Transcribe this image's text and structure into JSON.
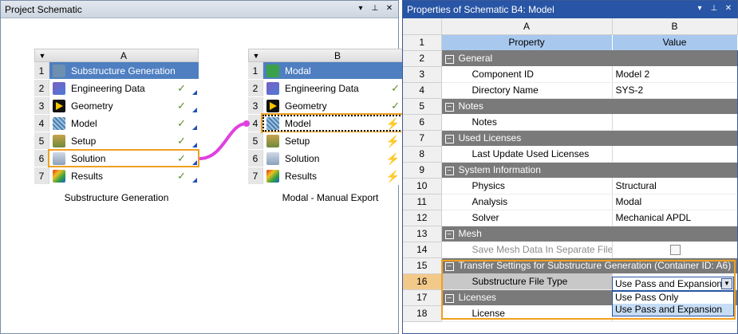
{
  "left_pane": {
    "title": "Project Schematic",
    "system_a": {
      "column": "A",
      "caption": "Substructure Generation",
      "rows": [
        {
          "num": "1",
          "label": "Substructure Generation",
          "icon": "substructure-icon",
          "status": ""
        },
        {
          "num": "2",
          "label": "Engineering Data",
          "icon": "engineering-data-icon",
          "status": "✓"
        },
        {
          "num": "3",
          "label": "Geometry",
          "icon": "geometry-icon",
          "status": "✓"
        },
        {
          "num": "4",
          "label": "Model",
          "icon": "model-icon",
          "status": "✓"
        },
        {
          "num": "5",
          "label": "Setup",
          "icon": "setup-icon",
          "status": "✓"
        },
        {
          "num": "6",
          "label": "Solution",
          "icon": "solution-icon",
          "status": "✓"
        },
        {
          "num": "7",
          "label": "Results",
          "icon": "results-icon",
          "status": "✓"
        }
      ]
    },
    "system_b": {
      "column": "B",
      "caption": "Modal - Manual Export",
      "rows": [
        {
          "num": "1",
          "label": "Modal",
          "icon": "modal-icon",
          "status": ""
        },
        {
          "num": "2",
          "label": "Engineering Data",
          "icon": "engineering-data-icon",
          "status": "✓"
        },
        {
          "num": "3",
          "label": "Geometry",
          "icon": "geometry-icon",
          "status": "✓"
        },
        {
          "num": "4",
          "label": "Model",
          "icon": "model-icon",
          "status": "⚡"
        },
        {
          "num": "5",
          "label": "Setup",
          "icon": "setup-icon",
          "status": "⚡"
        },
        {
          "num": "6",
          "label": "Solution",
          "icon": "solution-icon",
          "status": "⚡"
        },
        {
          "num": "7",
          "label": "Results",
          "icon": "results-icon",
          "status": "⚡"
        }
      ]
    }
  },
  "right_pane": {
    "title": "Properties of Schematic B4: Model",
    "col_a": "A",
    "col_b": "B",
    "row1": {
      "num": "1",
      "property": "Property",
      "value": "Value"
    },
    "rows": [
      {
        "num": "2",
        "type": "cat",
        "label": "General"
      },
      {
        "num": "3",
        "type": "item",
        "label": "Component ID",
        "value": "Model 2"
      },
      {
        "num": "4",
        "type": "item",
        "label": "Directory Name",
        "value": "SYS-2"
      },
      {
        "num": "5",
        "type": "cat",
        "label": "Notes"
      },
      {
        "num": "6",
        "type": "item",
        "label": "Notes",
        "value": ""
      },
      {
        "num": "7",
        "type": "cat",
        "label": "Used Licenses"
      },
      {
        "num": "8",
        "type": "item",
        "label": "Last Update Used Licenses",
        "value": ""
      },
      {
        "num": "9",
        "type": "cat",
        "label": "System Information"
      },
      {
        "num": "10",
        "type": "item",
        "label": "Physics",
        "value": "Structural"
      },
      {
        "num": "11",
        "type": "item",
        "label": "Analysis",
        "value": "Modal"
      },
      {
        "num": "12",
        "type": "item",
        "label": "Solver",
        "value": "Mechanical APDL"
      },
      {
        "num": "13",
        "type": "cat",
        "label": "Mesh"
      },
      {
        "num": "14",
        "type": "check",
        "label": "Save Mesh Data In Separate File",
        "value": ""
      },
      {
        "num": "15",
        "type": "cat",
        "label": "Transfer Settings for Substructure Generation (Container ID: A6)"
      },
      {
        "num": "16",
        "type": "sel",
        "label": "Substructure File Type",
        "value": ""
      },
      {
        "num": "17",
        "type": "cat",
        "label": "Licenses"
      },
      {
        "num": "18",
        "type": "item",
        "label": "License",
        "value": ""
      }
    ],
    "dropdown": {
      "selected": "Use Pass and Expansion",
      "options": [
        "Use Pass Only",
        "Use Pass and Expansion"
      ]
    }
  },
  "colors": {
    "accent": "#2855a5",
    "highlight": "#f0a020",
    "link": "#e040e0"
  }
}
